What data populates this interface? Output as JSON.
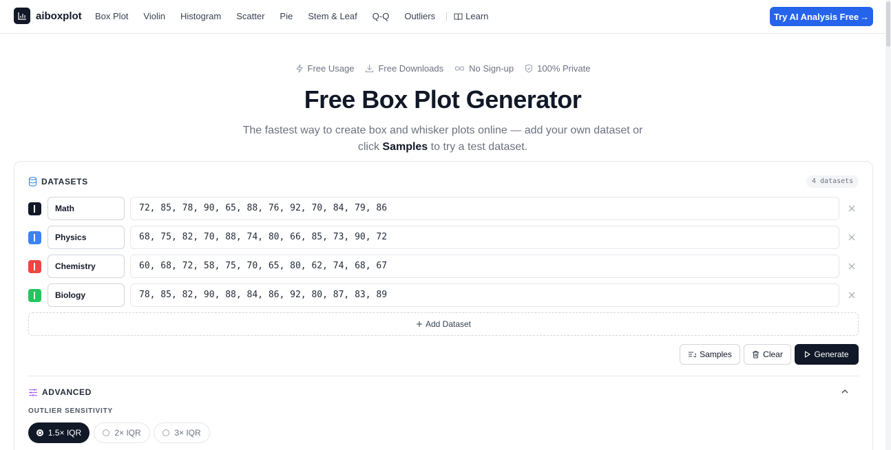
{
  "header": {
    "logo_text": "aiboxplot",
    "nav": [
      "Box Plot",
      "Violin",
      "Histogram",
      "Scatter",
      "Pie",
      "Stem & Leaf",
      "Q-Q",
      "Outliers"
    ],
    "learn_label": "Learn",
    "cta_label": "Try AI Analysis Free",
    "cta_arrow": "→"
  },
  "features": [
    {
      "icon": "bolt-icon",
      "label": "Free Usage"
    },
    {
      "icon": "download-icon",
      "label": "Free Downloads"
    },
    {
      "icon": "infinity-icon",
      "label": "No Sign-up"
    },
    {
      "icon": "shield-icon",
      "label": "100% Private"
    }
  ],
  "hero": {
    "title": "Free Box Plot Generator",
    "subtitle_before": "The fastest way to create box and whisker plots online — add your own dataset or click",
    "subtitle_bold": "Samples",
    "subtitle_after": "to try a test dataset."
  },
  "datasets": {
    "heading": "DATASETS",
    "count": "4 datasets",
    "rows": [
      {
        "name": "Math",
        "values": "72, 85, 78, 90, 65, 88, 76, 92, 70, 84, 79, 86",
        "color": "#111827"
      },
      {
        "name": "Physics",
        "values": "68, 75, 82, 70, 88, 74, 80, 66, 85, 73, 90, 72",
        "color": "#3b82f6"
      },
      {
        "name": "Chemistry",
        "values": "60, 68, 72, 58, 75, 70, 65, 80, 62, 74, 68, 67",
        "color": "#ef4444"
      },
      {
        "name": "Biology",
        "values": "78, 85, 82, 90, 88, 84, 86, 92, 80, 87, 83, 89",
        "color": "#22c55e"
      }
    ],
    "add_label": "Add Dataset",
    "samples_label": "Samples",
    "clear_label": "Clear",
    "generate_label": "Generate"
  },
  "advanced": {
    "heading": "ADVANCED",
    "sensitivity_label": "OUTLIER SENSITIVITY",
    "options": [
      "1.5× IQR",
      "2× IQR",
      "3× IQR"
    ],
    "selected": "1.5× IQR"
  },
  "colors": {
    "accent": "#2563eb",
    "dark": "#111827"
  }
}
